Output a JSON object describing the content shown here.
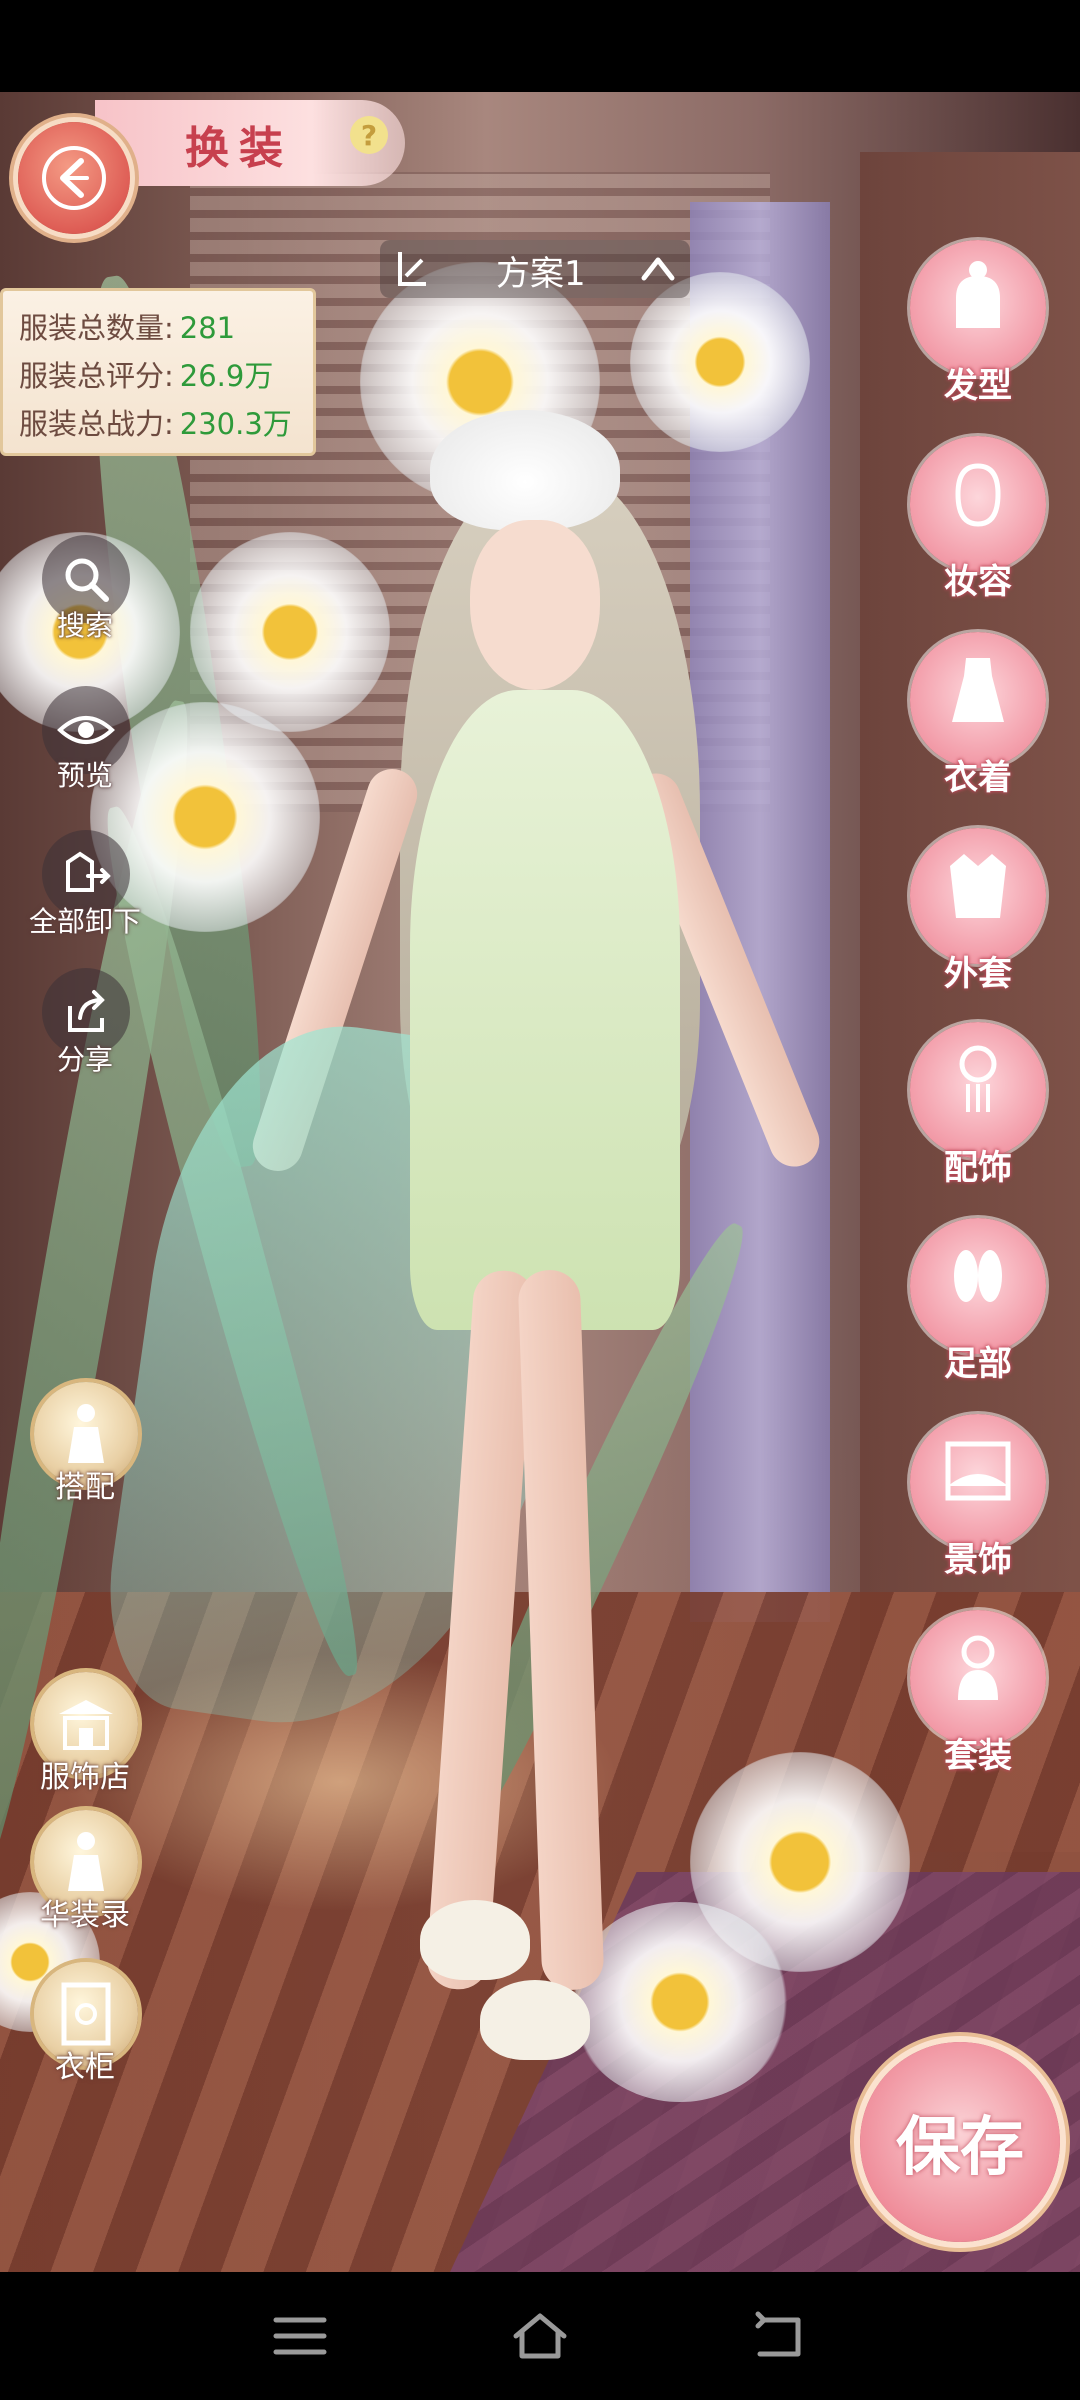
{
  "header": {
    "title": "换装",
    "help_glyph": "?"
  },
  "plan": {
    "name": "方案1"
  },
  "stats": {
    "count_label": "服装总数量:",
    "count_value": "281",
    "score_label": "服装总评分:",
    "score_value": "26.9万",
    "power_label": "服装总战力:",
    "power_value": "230.3万"
  },
  "left_tools": [
    {
      "label": "搜索",
      "icon": "search-icon"
    },
    {
      "label": "预览",
      "icon": "eye-icon"
    },
    {
      "label": "全部卸下",
      "icon": "unequip-icon"
    },
    {
      "label": "分享",
      "icon": "share-icon"
    }
  ],
  "left_menu": [
    {
      "label": "搭配",
      "icon": "outfit-icon"
    },
    {
      "label": "服饰店",
      "icon": "shop-icon"
    },
    {
      "label": "华装录",
      "icon": "catalog-icon"
    },
    {
      "label": "衣柜",
      "icon": "wardrobe-icon"
    }
  ],
  "categories": [
    {
      "label": "发型",
      "icon": "hairstyle-icon"
    },
    {
      "label": "妆容",
      "icon": "makeup-icon"
    },
    {
      "label": "衣着",
      "icon": "dress-icon"
    },
    {
      "label": "外套",
      "icon": "coat-icon"
    },
    {
      "label": "配饰",
      "icon": "accessory-icon"
    },
    {
      "label": "足部",
      "icon": "shoes-icon"
    },
    {
      "label": "景饰",
      "icon": "scenery-icon"
    },
    {
      "label": "套装",
      "icon": "suit-icon"
    }
  ],
  "save": {
    "label": "保存"
  },
  "colors": {
    "accent_pink": "#f29aa7",
    "title_red": "#c7404e",
    "stat_value_green": "#2e9a3a",
    "gold": "#d8b67e"
  }
}
